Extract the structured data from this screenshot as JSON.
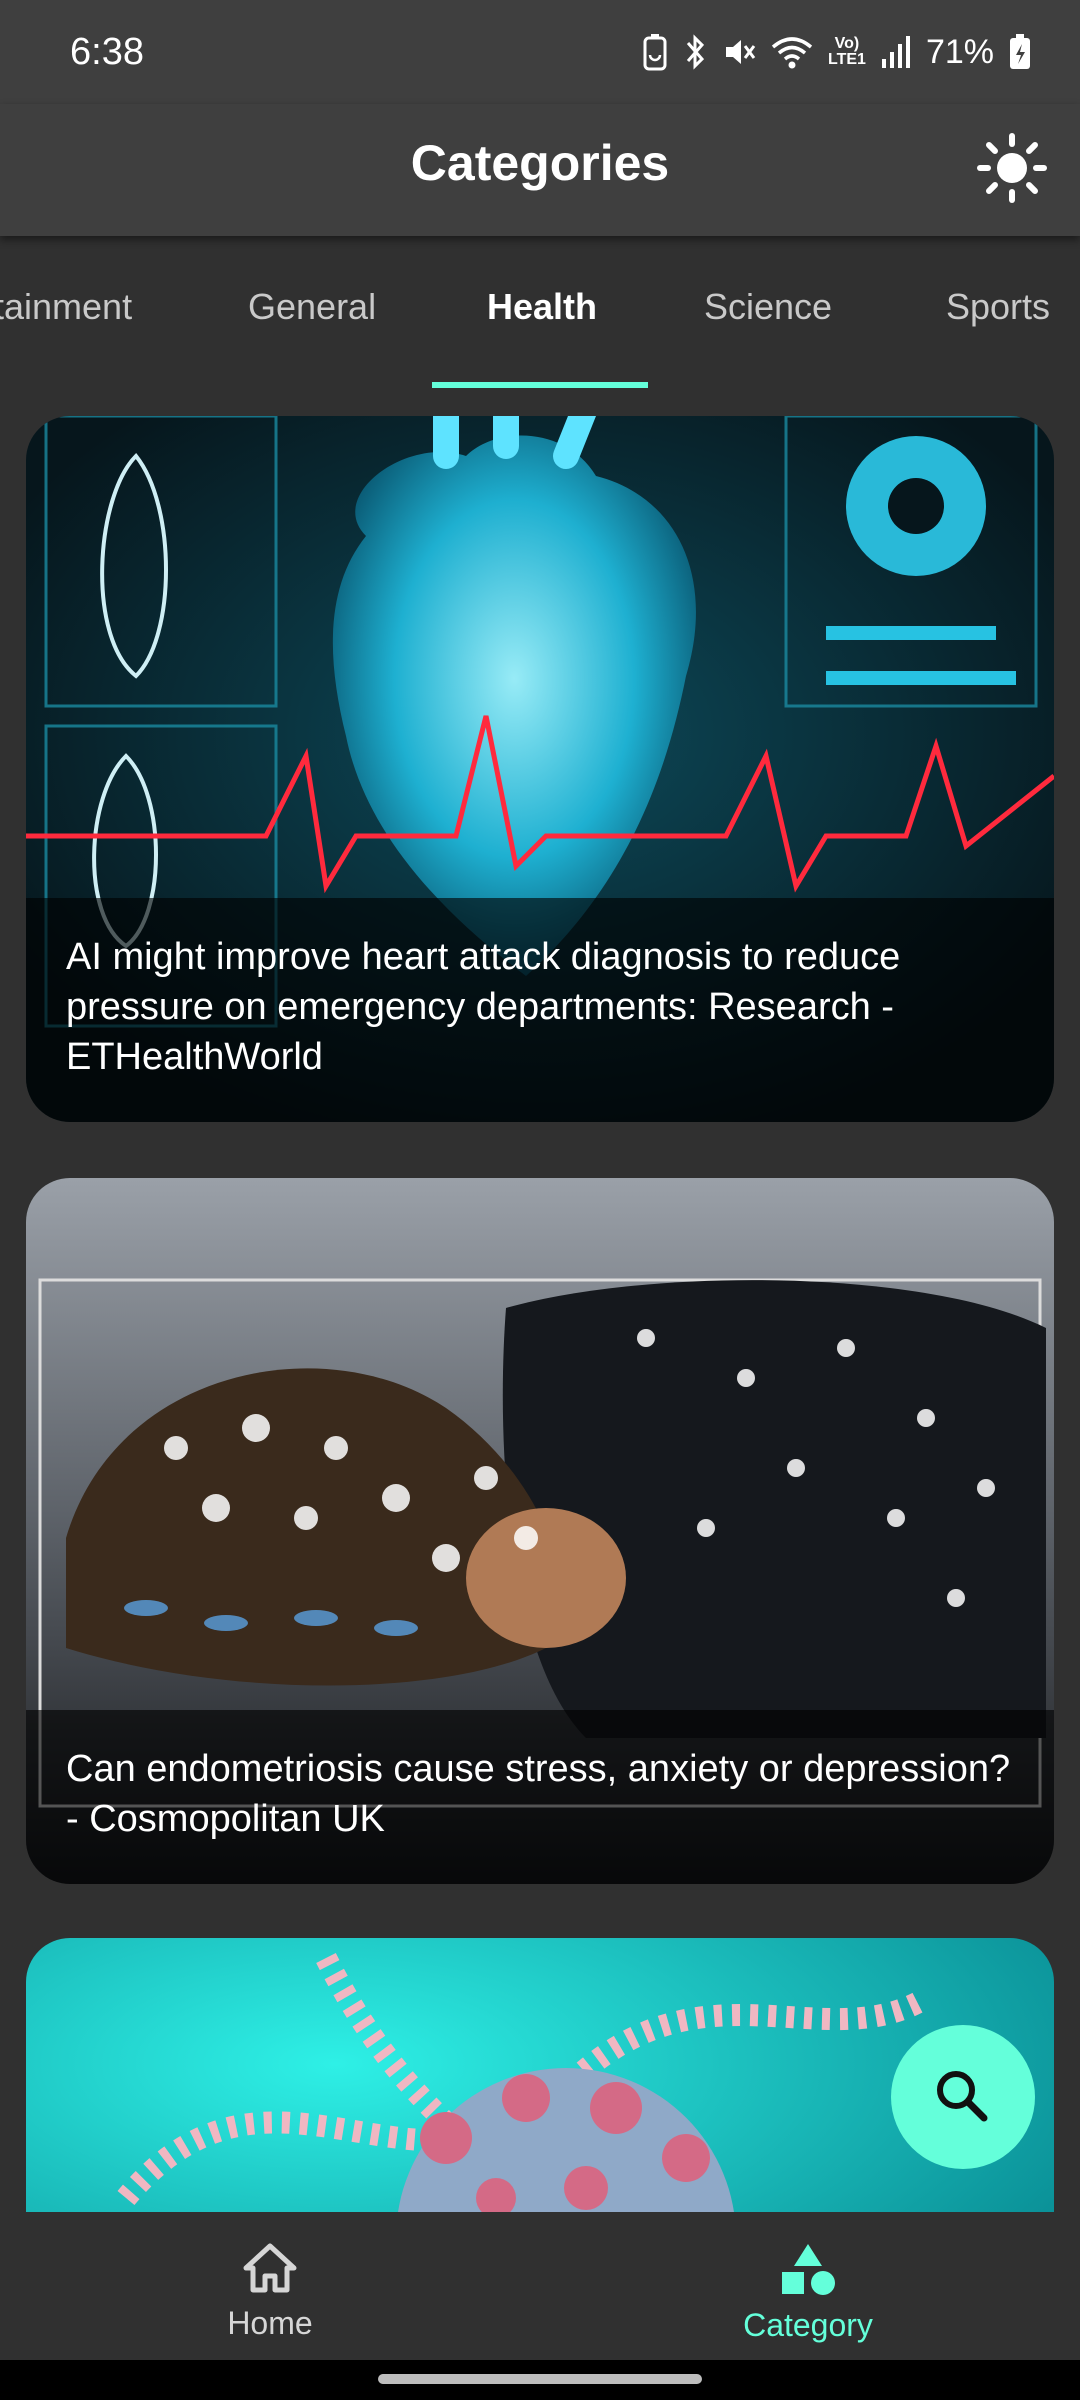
{
  "status_bar": {
    "time": "6:38",
    "volte": "Vo)",
    "lte": "LTE1",
    "battery": "71%",
    "icons": [
      "battery-saver-icon",
      "bluetooth-icon",
      "mute-icon",
      "wifi-icon",
      "signal-icon",
      "battery-icon"
    ]
  },
  "app_bar": {
    "title": "Categories",
    "theme_icon": "sun-icon"
  },
  "tabs": [
    {
      "label": "tainment"
    },
    {
      "label": "General"
    },
    {
      "label": "Health"
    },
    {
      "label": "Science"
    },
    {
      "label": "Sports"
    }
  ],
  "active_tab": "Health",
  "articles": [
    {
      "title": "AI might improve heart attack diagnosis to reduce pressure on emergency departments: Research - ETHealthWorld"
    },
    {
      "title": "Can endometriosis cause stress, anxiety or depression? - Cosmopolitan UK"
    },
    {
      "title": ""
    }
  ],
  "fab": {
    "icon": "search-icon"
  },
  "bottom_nav": {
    "home": {
      "label": "Home",
      "icon": "home-icon"
    },
    "category": {
      "label": "Category",
      "icon": "shapes-icon"
    }
  },
  "colors": {
    "accent": "#64ffda",
    "background": "#303030",
    "app_bar": "#3f3f3f"
  }
}
